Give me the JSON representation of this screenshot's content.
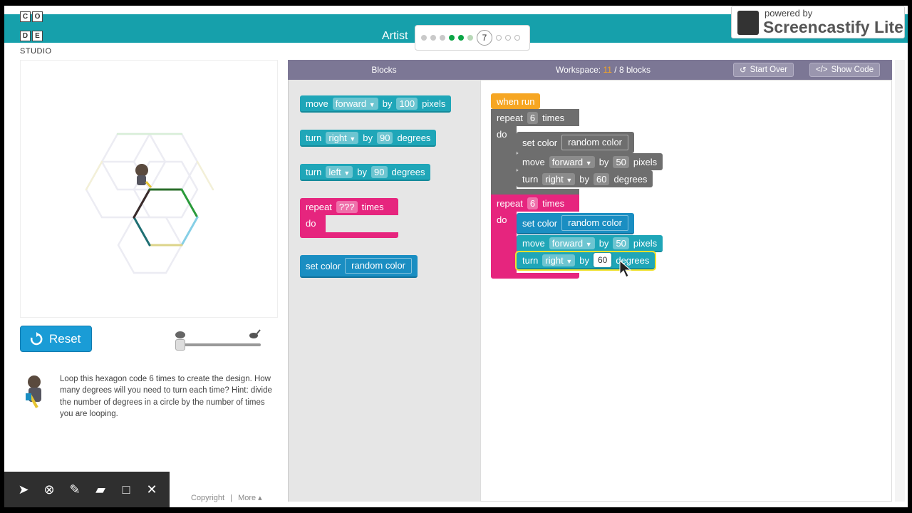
{
  "header": {
    "logo_letters": [
      "C",
      "O",
      "",
      "D",
      "E",
      ""
    ],
    "logo_sub": "STUDIO",
    "level_title": "Artist",
    "current_level": "7",
    "dots": [
      "done",
      "done",
      "done",
      "green",
      "green",
      "light"
    ],
    "future_dots": 3
  },
  "watermark": {
    "small": "powered by",
    "big": "Screencastify Lite"
  },
  "controls": {
    "reset_label": "Reset"
  },
  "instructions": {
    "text": "Loop this hexagon code 6 times to create the design. How many degrees will you need to turn each time? Hint: divide the number of degrees in a circle by the number of times you are looping."
  },
  "footer": {
    "copyright": "Copyright",
    "separator": "|",
    "more": "More ▴"
  },
  "toolbox": {
    "title": "Blocks",
    "blocks": {
      "move": {
        "word": "move",
        "dir": "forward",
        "by": "by",
        "value": "100",
        "unit": "pixels"
      },
      "turn_right": {
        "word": "turn",
        "dir": "right",
        "by": "by",
        "value": "90",
        "unit": "degrees"
      },
      "turn_left": {
        "word": "turn",
        "dir": "left",
        "by": "by",
        "value": "90",
        "unit": "degrees"
      },
      "repeat": {
        "word": "repeat",
        "value": "???",
        "unit": "times",
        "do": "do"
      },
      "set_color": {
        "word": "set color",
        "value": "random color"
      }
    }
  },
  "workspace": {
    "title_prefix": "Workspace:",
    "used": "11",
    "limit": "/ 8 blocks",
    "start_over": "Start Over",
    "show_code": "Show Code",
    "when_run": "when run",
    "repeat1": {
      "word": "repeat",
      "value": "6",
      "unit": "times",
      "do": "do",
      "set_color": "set color",
      "color_value": "random color",
      "move": {
        "word": "move",
        "dir": "forward",
        "by": "by",
        "value": "50",
        "unit": "pixels"
      },
      "turn": {
        "word": "turn",
        "dir": "right",
        "by": "by",
        "value": "60",
        "unit": "degrees"
      }
    },
    "repeat2": {
      "word": "repeat",
      "value": "6",
      "unit": "times",
      "do": "do",
      "set_color": "set color",
      "color_value": "random color",
      "move": {
        "word": "move",
        "dir": "forward",
        "by": "by",
        "value": "50",
        "unit": "pixels"
      },
      "turn": {
        "word": "turn",
        "dir": "right",
        "by": "by",
        "value": "60",
        "unit": "degrees"
      }
    }
  },
  "colors": {
    "header": "#16a0ab",
    "panel": "#7c7795",
    "teal": "#1fa6b8",
    "pink": "#e6257e",
    "gray": "#6e6e6e",
    "orange": "#f6a623",
    "blue": "#1a8ec2"
  }
}
